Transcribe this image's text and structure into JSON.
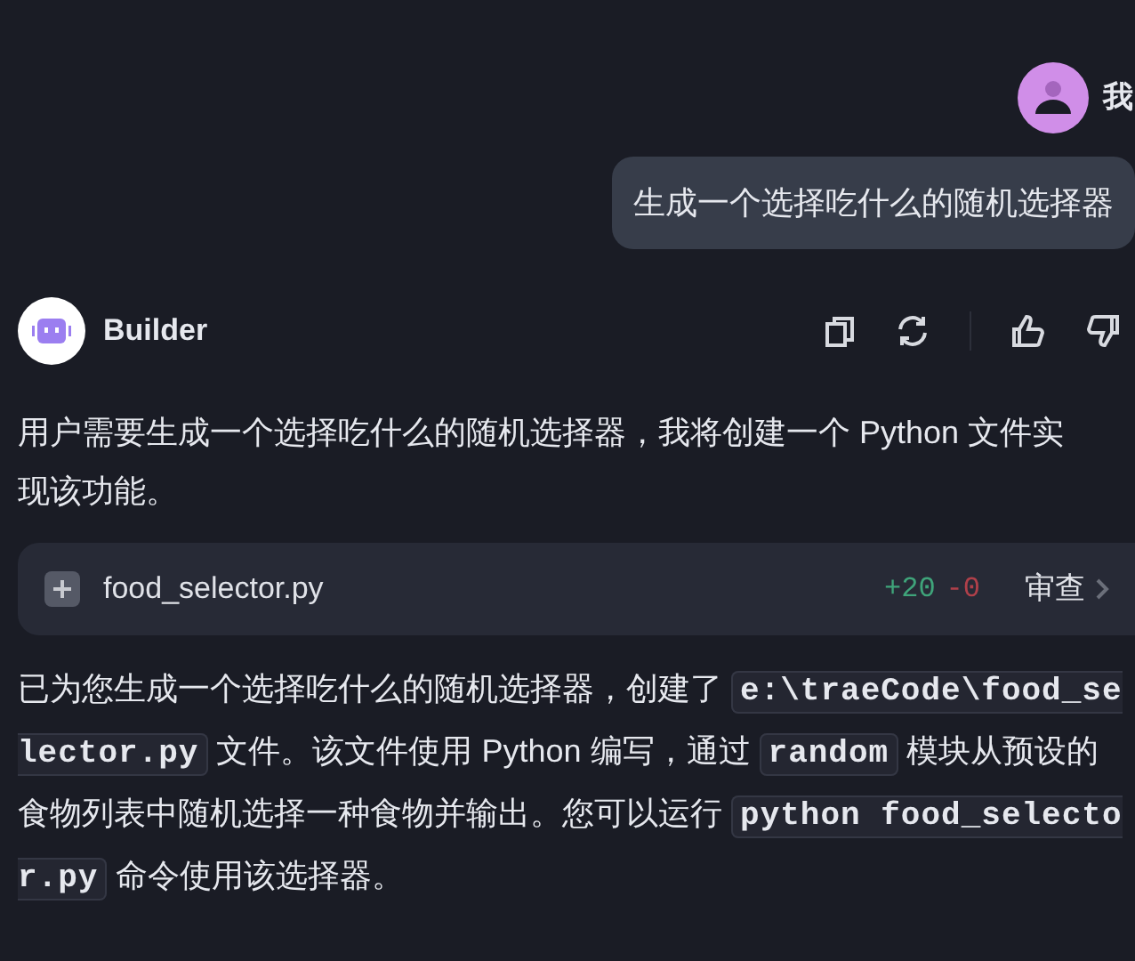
{
  "user_message": {
    "name": "我",
    "text": "生成一个选择吃什么的随机选择器"
  },
  "assistant": {
    "name": "Builder",
    "intro": "用户需要生成一个选择吃什么的随机选择器，我将创建一个 Python 文件实现该功能。",
    "file_card": {
      "filename": "food_selector.py",
      "added": "+20",
      "removed": "-0",
      "action": "审查"
    },
    "summary": [
      {
        "kind": "text",
        "text": "已为您生成一个选择吃什么的随机选择器，创建了 "
      },
      {
        "kind": "code",
        "text": "e:\\traeCode\\food_selector.py"
      },
      {
        "kind": "text",
        "text": " 文件。该文件使用 Python 编写，通过 "
      },
      {
        "kind": "code",
        "text": "random"
      },
      {
        "kind": "text",
        "text": " 模块从预设的食物列表中随机选择一种食物并输出。您可以运行 "
      },
      {
        "kind": "code",
        "text": "python food_selector.py"
      },
      {
        "kind": "text",
        "text": " 命令使用该选择器。"
      }
    ]
  }
}
